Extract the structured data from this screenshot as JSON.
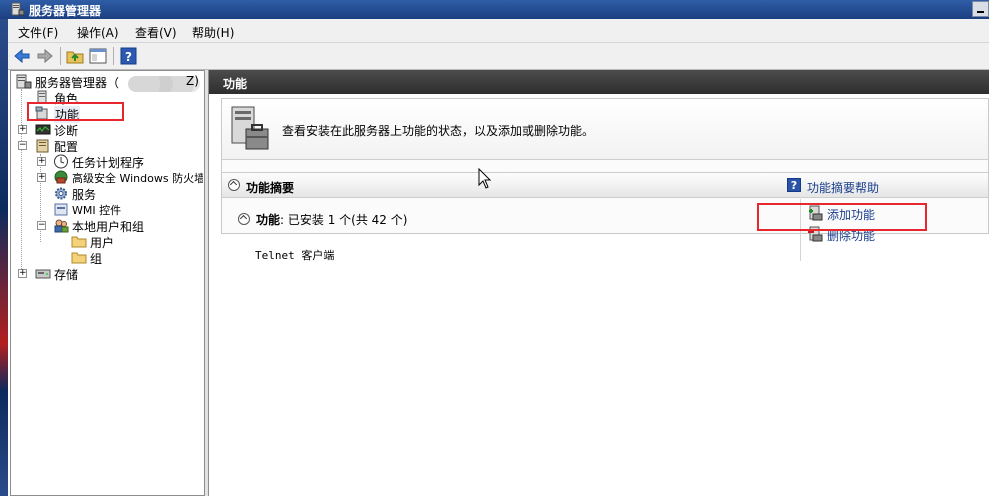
{
  "window": {
    "title": "服务器管理器"
  },
  "menubar": {
    "items": [
      "文件(F)",
      "操作(A)",
      "查看(V)",
      "帮助(H)"
    ]
  },
  "tree": {
    "root": {
      "label": "服务器管理器（",
      "suffix": "Z)"
    },
    "items": [
      {
        "label": "角色"
      },
      {
        "label": "功能"
      },
      {
        "label": "诊断"
      },
      {
        "label": "配置"
      },
      {
        "label": "任务计划程序"
      },
      {
        "label": "高级安全 Windows 防火墙"
      },
      {
        "label": "服务"
      },
      {
        "label": "WMI 控件"
      },
      {
        "label": "本地用户和组"
      },
      {
        "label": "用户"
      },
      {
        "label": "组"
      },
      {
        "label": "存储"
      }
    ]
  },
  "content": {
    "header_title": "功能",
    "intro_text": "查看安装在此服务器上功能的状态，以及添加或删除功能。",
    "summary_title": "功能摘要",
    "summary_help": "功能摘要帮助",
    "features_label": "功能",
    "features_status": ": 已安装 1 个(共 42 个)",
    "installed_features": [
      "Telnet 客户端"
    ],
    "actions": {
      "add": "添加功能",
      "remove": "删除功能"
    }
  },
  "colors": {
    "highlight_box": "#e8262d",
    "link": "#1a3e8c",
    "titlebar": "#2f5da6"
  }
}
